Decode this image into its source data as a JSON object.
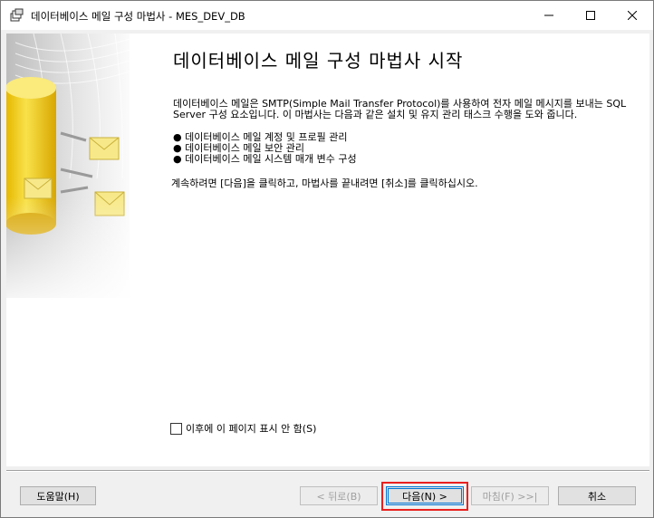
{
  "window": {
    "title": "데이터베이스 메일 구성 마법사 - MES_DEV_DB"
  },
  "page": {
    "heading": "데이터베이스 메일 구성 마법사 시작",
    "description": "데이터베이스 메일은 SMTP(Simple Mail Transfer Protocol)를 사용하여 전자 메일 메시지를 보내는 SQL Server 구성 요소입니다. 이 마법사는 다음과 같은 설치 및 유지 관리 태스크 수행을 도와 줍니다.",
    "bullets": [
      "데이터베이스 메일 계정 및 프로필 관리",
      "데이터베이스 메일 보안 관리",
      "데이터베이스 메일 시스템 매개 변수 구성"
    ],
    "bullet_glyph": "●",
    "continue_text": "계속하려면 [다음]을 클릭하고, 마법사를 끝내려면 [취소]를 클릭하십시오.",
    "dont_show_label": "이후에 이 페이지 표시 안 함(S)",
    "dont_show_checked": false
  },
  "buttons": {
    "help": "도움말(H)",
    "back": "< 뒤로(B)",
    "next": "다음(N) >",
    "finish": "마침(F) >>|",
    "cancel": "취소"
  },
  "colors": {
    "highlight": "#e8201e",
    "focus": "#0078d7",
    "accent_yellow": "#f2d21a"
  },
  "icons": [
    "app-wizard-icon",
    "minimize-icon",
    "maximize-icon",
    "close-icon",
    "database-mail-illustration"
  ]
}
